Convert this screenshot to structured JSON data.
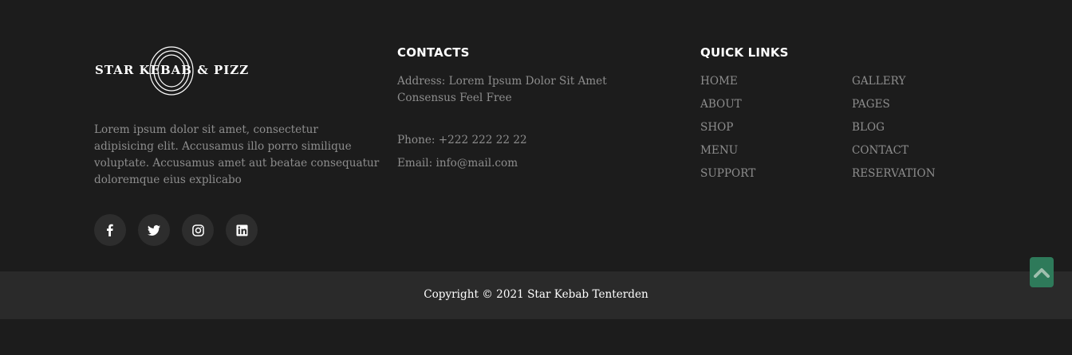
{
  "brand": {
    "logo_text": "STAR KEBAB & PIZZ",
    "about": "Lorem ipsum dolor sit amet, consectetur adipisicing elit. Accusamus illo porro similique voluptate. Accusamus amet aut beatae consequatur doloremque eius explicabo"
  },
  "socials": [
    {
      "name": "facebook-icon"
    },
    {
      "name": "twitter-icon"
    },
    {
      "name": "instagram-icon"
    },
    {
      "name": "linkedin-icon"
    }
  ],
  "contacts": {
    "title": "CONTACTS",
    "address": "Address: Lorem Ipsum Dolor Sit Amet Consensus Feel Free",
    "phone": "Phone: +222 222 22 22",
    "email": "Email: info@mail.com"
  },
  "quick_links": {
    "title": "QUICK LINKS",
    "column_a": [
      "HOME",
      "ABOUT",
      "SHOP",
      "MENU",
      "SUPPORT"
    ],
    "column_b": [
      "GALLERY",
      "PAGES",
      "BLOG",
      "CONTACT",
      "RESERVATION"
    ]
  },
  "footer": {
    "copyright": "Copyright © 2021 Star Kebab Tenterden"
  },
  "colors": {
    "background": "#1c1c1c",
    "bottom_bar": "#2a2a2a",
    "accent": "#2e7a5a",
    "text_muted": "#8d8d8d",
    "text_light": "#ffffff"
  }
}
